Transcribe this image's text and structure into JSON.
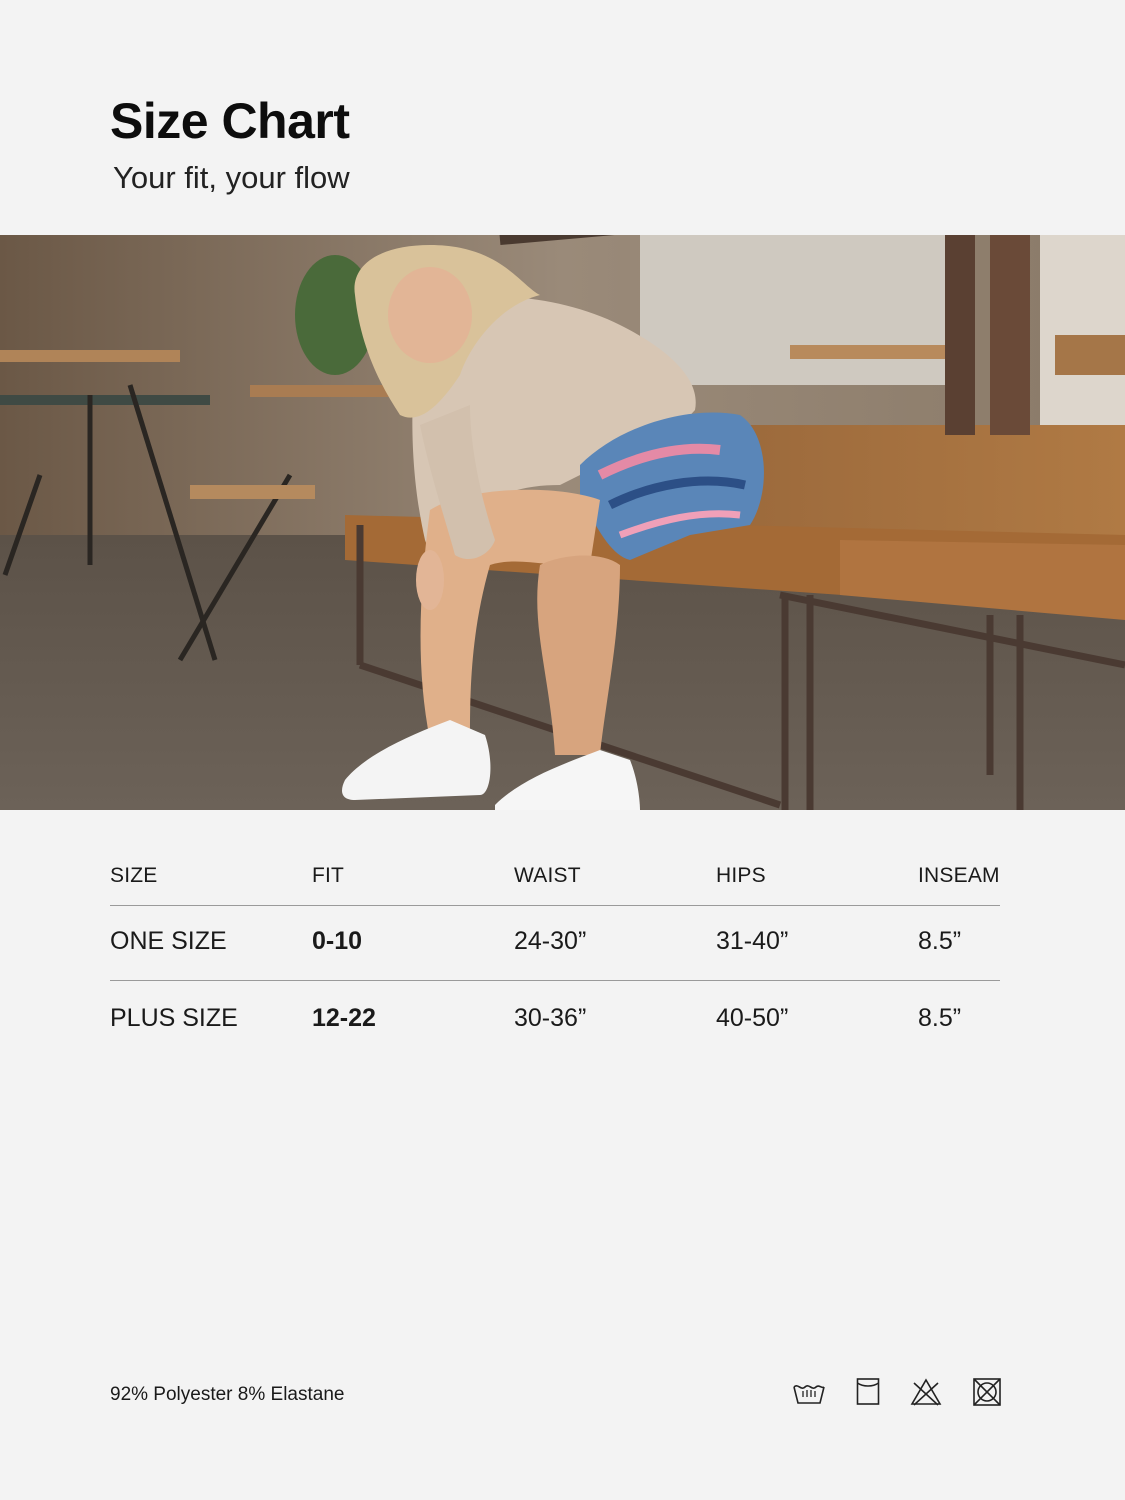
{
  "header": {
    "title": "Size Chart",
    "subtitle": "Your fit, your flow"
  },
  "photo": {
    "description_icon": "lifestyle-photo"
  },
  "table": {
    "headers": [
      "SIZE",
      "FIT",
      "WAIST",
      "HIPS",
      "INSEAM"
    ],
    "rows": [
      [
        "ONE SIZE",
        "0-10",
        "24-30”",
        "31-40”",
        "8.5”"
      ],
      [
        "PLUS SIZE",
        "12-22",
        "30-36”",
        "40-50”",
        "8.5”"
      ]
    ]
  },
  "footer": {
    "material": "92% Polyester 8% Elastane",
    "care_icons": [
      "hand-wash-icon",
      "tumble-dry-icon",
      "do-not-bleach-icon",
      "do-not-tumble-dry-icon"
    ]
  },
  "colors": {
    "background": "#f3f3f3",
    "text": "#111111",
    "rule": "#9a9a9a"
  }
}
